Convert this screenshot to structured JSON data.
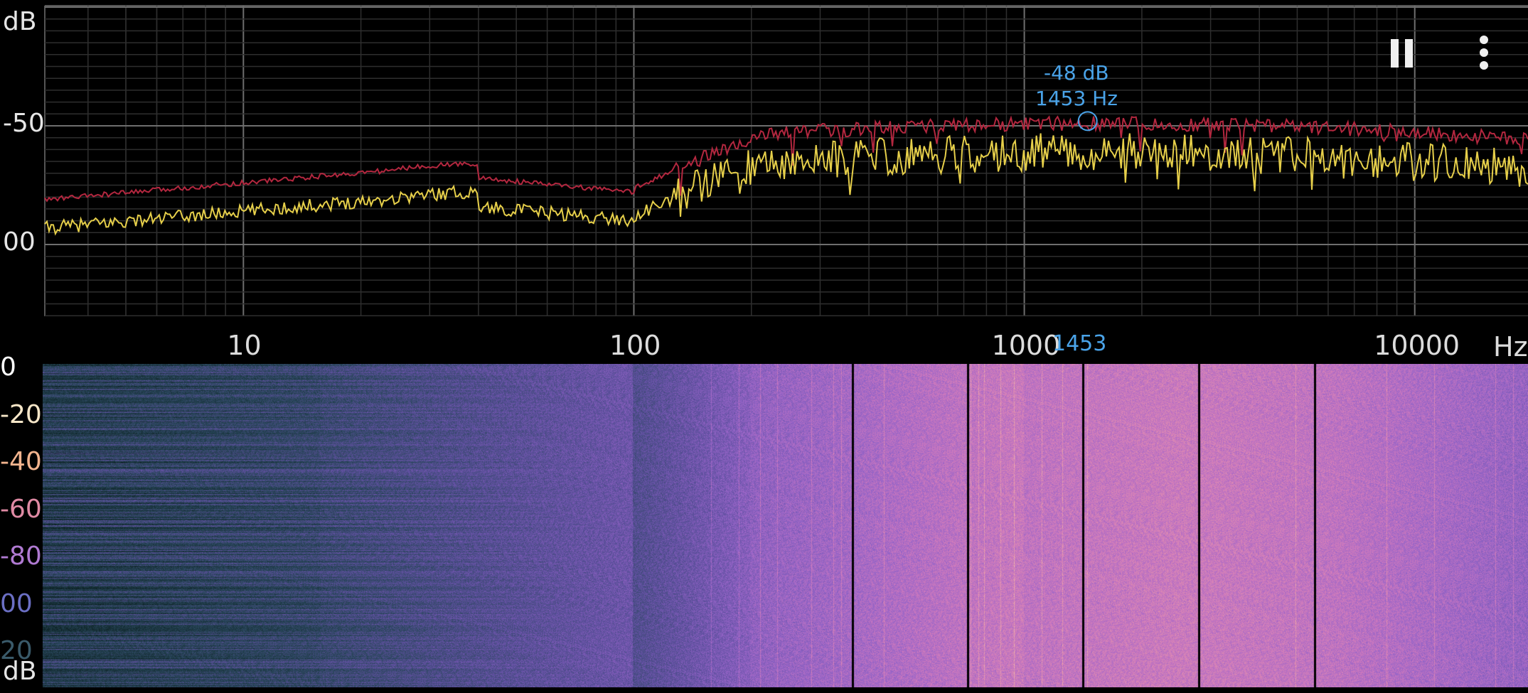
{
  "spectrum": {
    "y_unit": "dB",
    "y_ticks": [
      {
        "label": "-50",
        "db": -50
      },
      {
        "label": "00",
        "db": -100
      }
    ],
    "x_unit": "Hz",
    "x_ticks": [
      {
        "label": "10",
        "hz": 10
      },
      {
        "label": "100",
        "hz": 100
      },
      {
        "label": "1000",
        "hz": 1000
      },
      {
        "label": "10000",
        "hz": 10000
      }
    ],
    "cursor": {
      "db_label": "-48 dB",
      "hz_label": "1453 Hz",
      "axis_label": "1453",
      "db": -48,
      "hz": 1453
    },
    "peak_color": "#b3273f",
    "live_color": "#e6cf4a",
    "cursor_color": "#4aa3e8"
  },
  "toolbar": {
    "pause_icon": "pause-icon",
    "menu_icon": "more-vert-icon"
  },
  "spectrogram": {
    "y_unit": "dB",
    "y_labels": [
      {
        "label": "0",
        "color": "#ffffff"
      },
      {
        "label": "-20",
        "color": "#f6e6c8"
      },
      {
        "label": "-40",
        "color": "#f2b48e"
      },
      {
        "label": "-60",
        "color": "#e08aa4"
      },
      {
        "label": "-80",
        "color": "#b07ad2"
      },
      {
        "label": "00",
        "color": "#6b6fc4"
      },
      {
        "label": "20",
        "color": "#3a5a6a"
      }
    ]
  }
}
